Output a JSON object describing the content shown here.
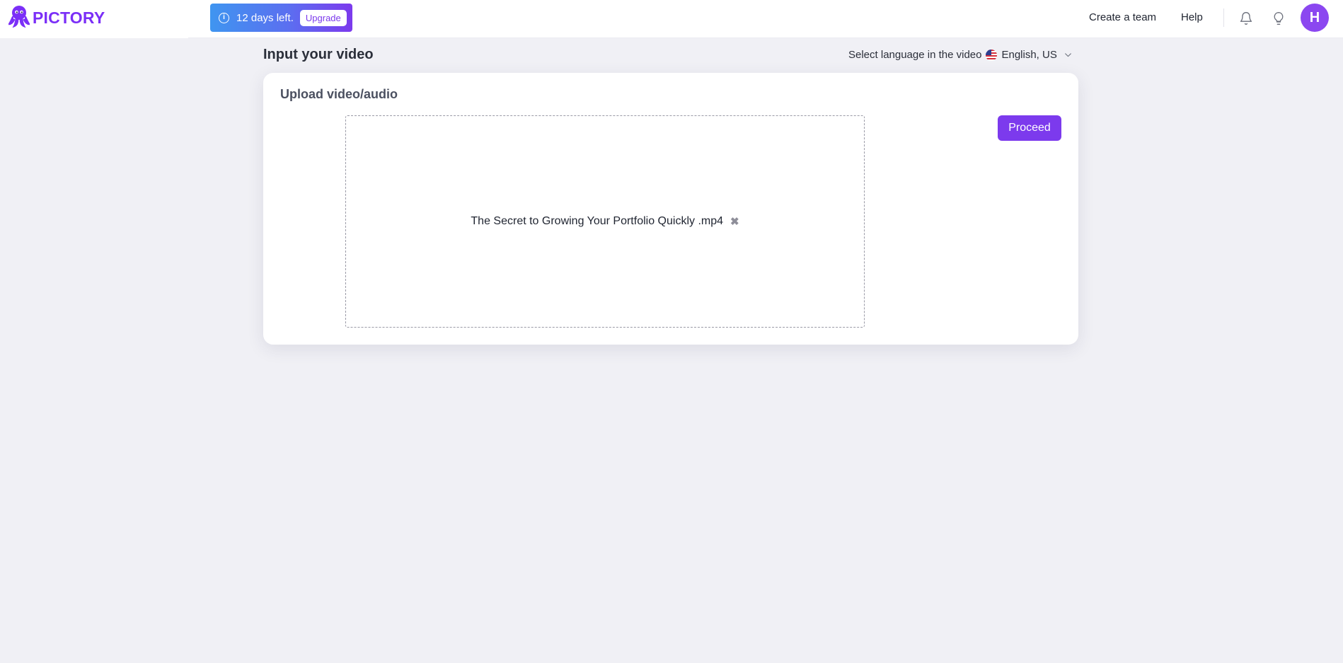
{
  "header": {
    "logo_text": "PICTORY",
    "trial_days": "12 days left.",
    "upgrade_label": "Upgrade",
    "create_team_label": "Create a team",
    "help_label": "Help",
    "avatar_initial": "H",
    "icons": [
      "octopus-logo-icon",
      "info-icon",
      "bell-icon",
      "lightbulb-icon"
    ]
  },
  "page": {
    "title": "Input your video",
    "language_prompt": "Select language in the video",
    "language_value": "English, US"
  },
  "upload": {
    "card_title": "Upload video/audio",
    "file_name": "The Secret to Growing Your Portfolio Quickly .mp4",
    "remove_glyph": "✖",
    "proceed_label": "Proceed"
  },
  "colors": {
    "brand": "#7c3aed",
    "trial_gradient_start": "#3f95f0",
    "trial_gradient_end": "#7c3aed",
    "page_bg": "#f0f0f5"
  }
}
